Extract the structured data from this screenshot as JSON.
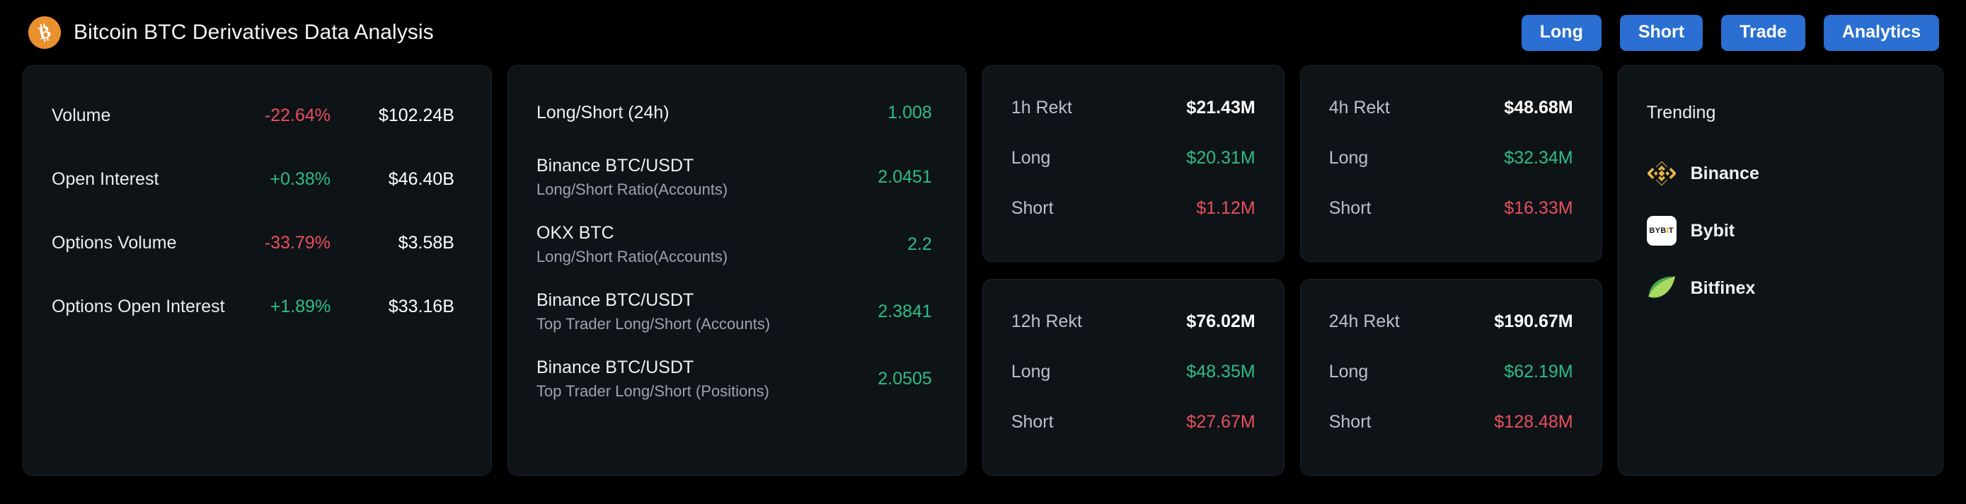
{
  "header": {
    "logo_icon": "bitcoin-icon",
    "title": "Bitcoin BTC Derivatives Data Analysis",
    "buttons": [
      {
        "label": "Long"
      },
      {
        "label": "Short"
      },
      {
        "label": "Trade"
      },
      {
        "label": "Analytics"
      }
    ]
  },
  "metrics": {
    "rows": [
      {
        "label": "Volume",
        "change": "-22.64%",
        "direction": "down",
        "value": "$102.24B"
      },
      {
        "label": "Open Interest",
        "change": "+0.38%",
        "direction": "up",
        "value": "$46.40B"
      },
      {
        "label": "Options Volume",
        "change": "-33.79%",
        "direction": "down",
        "value": "$3.58B"
      },
      {
        "label": "Options Open Interest",
        "change": "+1.89%",
        "direction": "up",
        "value": "$33.16B"
      }
    ]
  },
  "ratios": {
    "rows": [
      {
        "name": "Long/Short (24h)",
        "sub": "",
        "value": "1.008"
      },
      {
        "name": "Binance BTC/USDT",
        "sub": "Long/Short Ratio(Accounts)",
        "value": "2.0451"
      },
      {
        "name": "OKX BTC",
        "sub": "Long/Short Ratio(Accounts)",
        "value": "2.2"
      },
      {
        "name": "Binance BTC/USDT",
        "sub": "Top Trader Long/Short (Accounts)",
        "value": "2.3841"
      },
      {
        "name": "Binance BTC/USDT",
        "sub": "Top Trader Long/Short (Positions)",
        "value": "2.0505"
      }
    ]
  },
  "rekt": {
    "long_label": "Long",
    "short_label": "Short",
    "cards": [
      {
        "period_label": "1h Rekt",
        "total": "$21.43M",
        "long": "$20.31M",
        "short": "$1.12M"
      },
      {
        "period_label": "4h Rekt",
        "total": "$48.68M",
        "long": "$32.34M",
        "short": "$16.33M"
      },
      {
        "period_label": "12h Rekt",
        "total": "$76.02M",
        "long": "$48.35M",
        "short": "$27.67M"
      },
      {
        "period_label": "24h Rekt",
        "total": "$190.67M",
        "long": "$62.19M",
        "short": "$128.48M"
      }
    ]
  },
  "trending": {
    "title": "Trending",
    "items": [
      {
        "name": "Binance",
        "icon": "binance-icon"
      },
      {
        "name": "Bybit",
        "icon": "bybit-icon"
      },
      {
        "name": "Bitfinex",
        "icon": "bitfinex-icon"
      }
    ],
    "bybit_mark": {
      "part1": "BYB",
      "part2": "I",
      "part3": "T"
    }
  },
  "colors": {
    "background": "#000000",
    "card": "#0e1318",
    "card_border": "#1d242c",
    "accent_blue": "#2a6fd1",
    "up_green": "#2ebd85",
    "down_red": "#e8505b",
    "bitcoin_orange": "#e9912f",
    "binance_gold": "#eab54a",
    "bybit_orange": "#f7a600",
    "bitfinex_green": "#4caf50"
  }
}
